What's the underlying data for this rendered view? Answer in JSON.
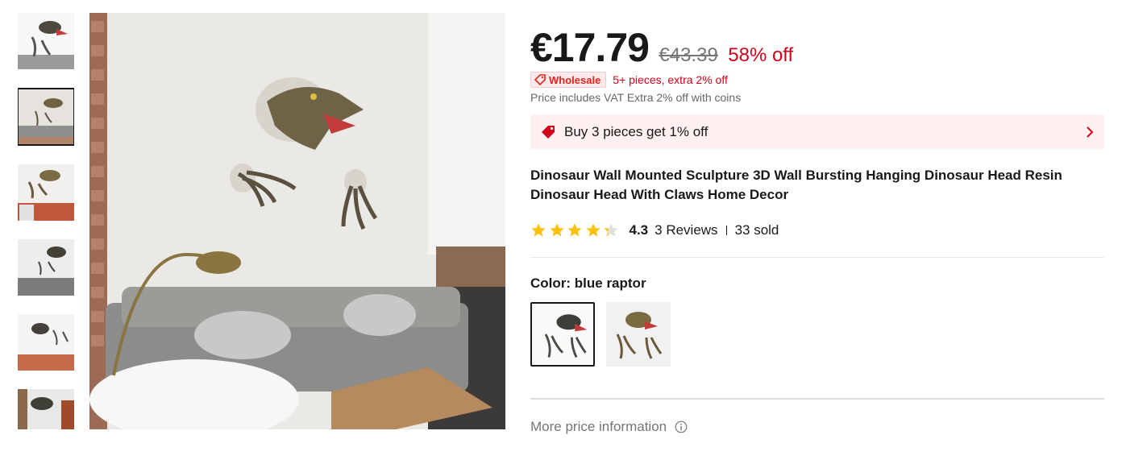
{
  "gallery": {
    "thumbnails": [
      {
        "alt": "dinosaur head thumbnail 1",
        "active": false
      },
      {
        "alt": "dinosaur head thumbnail 2",
        "active": true
      },
      {
        "alt": "dinosaur head thumbnail 3",
        "active": false
      },
      {
        "alt": "dinosaur head thumbnail 4",
        "active": false
      },
      {
        "alt": "dinosaur head thumbnail 5",
        "active": false
      },
      {
        "alt": "dinosaur head thumbnail 6",
        "active": false
      }
    ]
  },
  "price": {
    "current": "€17.79",
    "original": "€43.39",
    "discount": "58% off"
  },
  "wholesale": {
    "badge": "Wholesale",
    "text": "5+ pieces, extra 2% off"
  },
  "vat_note": "Price includes VAT Extra 2% off with coins",
  "promo": {
    "label": "Buy 3 pieces get 1% off"
  },
  "product": {
    "title": "Dinosaur Wall Mounted Sculpture 3D Wall Bursting Hanging Dinosaur Head Resin Dinosaur Head With Claws Home Decor"
  },
  "rating": {
    "value": "4.3",
    "stars": 4.3,
    "reviews": "3 Reviews",
    "sold": "33 sold"
  },
  "color": {
    "label": "Color: blue raptor",
    "options": [
      {
        "name": "blue raptor",
        "selected": true
      },
      {
        "name": "brown raptor",
        "selected": false
      }
    ]
  },
  "more_price_info": "More price information",
  "colors": {
    "accent_red": "#d0021b",
    "promo_bg": "#fff0f1",
    "star": "#fcc10e"
  }
}
